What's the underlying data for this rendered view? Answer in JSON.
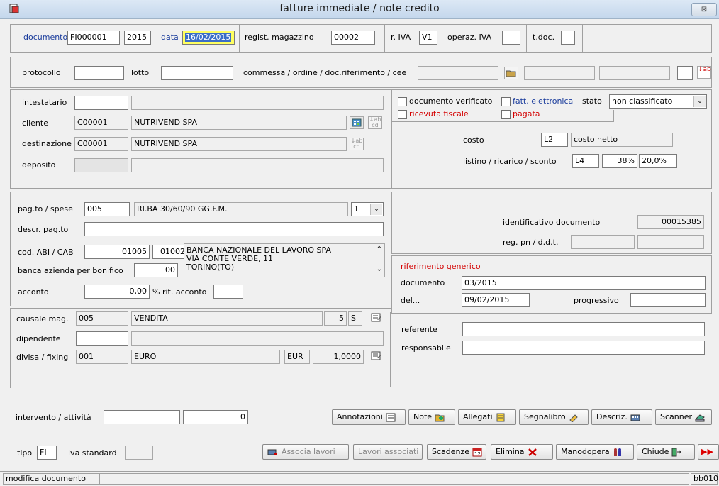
{
  "window": {
    "title": "fatture immediate / note credito",
    "close_label": "⊠"
  },
  "header": {
    "documento_label": "documento",
    "documento_value": "FI000001",
    "anno_value": "2015",
    "data_label": "data",
    "data_value": "16/02/2015",
    "regist_label": "regist. magazzino",
    "regist_value": "00002",
    "riva_label": "r. IVA",
    "riva_value": "V1",
    "operaz_label": "operaz. IVA",
    "operaz_value": "",
    "tdoc_label": "t.doc.",
    "tdoc_value": ""
  },
  "row2": {
    "protocollo_label": "protocollo",
    "protocollo_value": "",
    "lotto_label": "lotto",
    "lotto_value": "",
    "commessa_label": "commessa / ordine / doc.riferimento / cee"
  },
  "anagrafica": {
    "intestatario_label": "intestatario",
    "intestatario_code": "",
    "intestatario_name": "",
    "cliente_label": "cliente",
    "cliente_code": "C00001",
    "cliente_name": "NUTRIVEND SPA",
    "destinazione_label": "destinazione",
    "destinazione_code": "C00001",
    "destinazione_name": "NUTRIVEND SPA",
    "deposito_label": "deposito",
    "deposito_code": "",
    "deposito_name": ""
  },
  "flags": {
    "verificato_label": "documento verificato",
    "fatt_elettronica_label": "fatt. elettronica",
    "stato_label": "stato",
    "stato_value": "non classificato",
    "ricevuta_label": "ricevuta fiscale",
    "pagata_label": "pagata",
    "costo_label": "costo",
    "costo_code": "L2",
    "costo_value": "costo netto",
    "listino_label": "listino / ricarico / sconto",
    "listino_code": "L4",
    "ricarico_value": "38%",
    "sconto_value": "20,0%"
  },
  "pagamento": {
    "pagto_label": "pag.to / spese",
    "pagto_code": "005",
    "pagto_desc": "RI.BA 30/60/90 GG.F.M.",
    "pagto_sel": "1",
    "descr_label": "descr. pag.to",
    "descr_value": "",
    "abi_label": "cod. ABI / CAB",
    "abi_value": "01005",
    "cab_value": "01002",
    "banca_lines": [
      "BANCA NAZIONALE DEL LAVORO SPA",
      "VIA CONTE VERDE, 11",
      "TORINO(TO)"
    ],
    "bonifico_label": "banca azienda per bonifico",
    "bonifico_value": "00",
    "acconto_label": "acconto",
    "acconto_value": "0,00",
    "ritacconto_label": "% rit. acconto",
    "ritacconto_value": ""
  },
  "identificativo": {
    "id_label": "identificativo documento",
    "id_value": "00015385",
    "regpn_label": "reg. pn / d.d.t.",
    "regpn_value1": "",
    "regpn_value2": ""
  },
  "riferimento": {
    "title": "riferimento generico",
    "documento_label": "documento",
    "documento_value": "03/2015",
    "del_label": "del...",
    "del_value": "09/02/2015",
    "progressivo_label": "progressivo",
    "progressivo_value": ""
  },
  "causale": {
    "causale_label": "causale mag.",
    "causale_code": "005",
    "causale_desc": "VENDITA",
    "causale_num": "5",
    "causale_s": "S",
    "dipendente_label": "dipendente",
    "dipendente_code": "",
    "dipendente_name": "",
    "divisa_label": "divisa / fixing",
    "divisa_code": "001",
    "divisa_desc": "EURO",
    "divisa_sym": "EUR",
    "divisa_fixing": "1,0000"
  },
  "referente": {
    "referente_label": "referente",
    "referente_value": "",
    "responsabile_label": "responsabile",
    "responsabile_value": ""
  },
  "intervento": {
    "label": "intervento / attività",
    "value1": "",
    "value2": "0"
  },
  "toolbar1": {
    "annotazioni": "Annotazioni",
    "note": "Note",
    "allegati": "Allegati",
    "segnalibro": "Segnalibro",
    "descriz": "Descriz.",
    "scanner": "Scanner"
  },
  "footer": {
    "tipo_label": "tipo",
    "tipo_value": "FI",
    "iva_label": "iva standard",
    "iva_value": ""
  },
  "toolbar2": {
    "associa": "Associa lavori",
    "associati": "Lavori associati",
    "scadenze": "Scadenze",
    "elimina": "Elimina",
    "manodopera": "Manodopera",
    "chiude": "Chiude"
  },
  "status": {
    "left": "modifica documento",
    "right": "bb010"
  }
}
